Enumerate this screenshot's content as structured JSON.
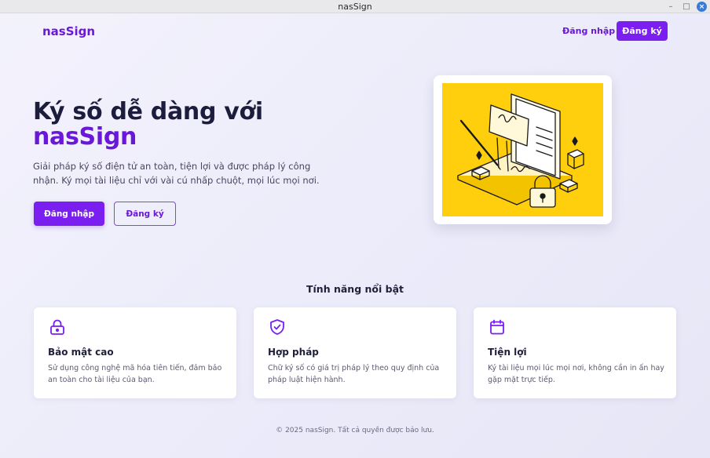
{
  "window": {
    "title": "nasSign",
    "controls": {
      "minimize": "–",
      "maximize": "□",
      "close": "×"
    }
  },
  "header": {
    "logo": "nasSign",
    "login_label": "Đăng nhập",
    "register_label": "Đăng ký"
  },
  "hero": {
    "title_line1": "Ký số dễ dàng với",
    "title_brand": "nasSign",
    "description": "Giải pháp ký số điện tử an toàn, tiện lợi và được pháp lý công nhận. Ký mọi tài liệu chỉ với vài cú nhấp chuột, mọi lúc mọi nơi.",
    "primary_button": "Đăng nhập",
    "secondary_button": "Đăng ký",
    "illustration_icon": "document-signing-illustration"
  },
  "features": {
    "title": "Tính năng nổi bật",
    "items": [
      {
        "icon": "lock-icon",
        "title": "Bảo mật cao",
        "description": "Sử dụng công nghệ mã hóa tiên tiến, đảm bảo an toàn cho tài liệu của bạn."
      },
      {
        "icon": "shield-check-icon",
        "title": "Hợp pháp",
        "description": "Chữ ký số có giá trị pháp lý theo quy định của pháp luật hiện hành."
      },
      {
        "icon": "calendar-icon",
        "title": "Tiện lợi",
        "description": "Ký tài liệu mọi lúc mọi nơi, không cần in ấn hay gặp mặt trực tiếp."
      }
    ]
  },
  "footer": {
    "text": "© 2025 nasSign. Tất cả quyền được bảo lưu."
  },
  "colors": {
    "accent": "#7a1ff0",
    "brand_text": "#6a18d8",
    "illustration_bg": "#ffcf0d",
    "page_bg": "#ededf8"
  }
}
